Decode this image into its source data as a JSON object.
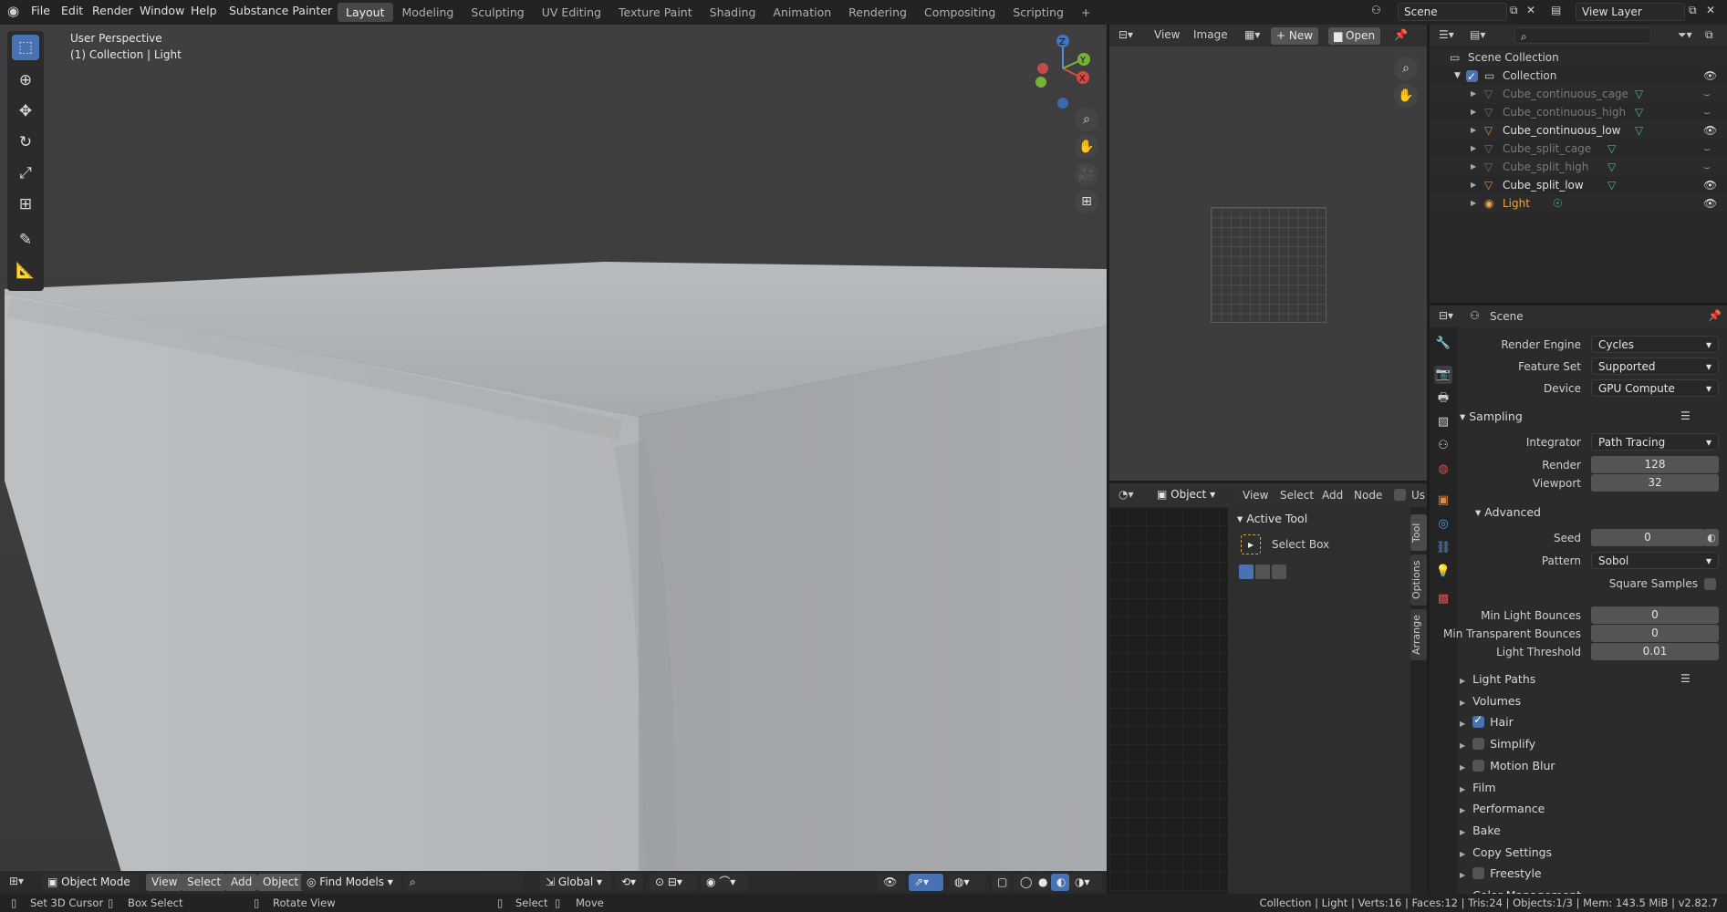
{
  "menu": [
    "File",
    "Edit",
    "Render",
    "Window",
    "Help",
    "Substance Painter"
  ],
  "workspaces": [
    "Layout",
    "Modeling",
    "Sculpting",
    "UV Editing",
    "Texture Paint",
    "Shading",
    "Animation",
    "Rendering",
    "Compositing",
    "Scripting"
  ],
  "active_workspace": "Layout",
  "scene_name": "Scene",
  "view_layer": "View Layer",
  "viewport": {
    "title": "User Perspective",
    "subtitle": "(1) Collection | Light",
    "mode": "Object Mode",
    "buttons": [
      "View",
      "Select",
      "Add",
      "Object"
    ],
    "find_models": "Find Models",
    "transform": "Global",
    "gizmo": {
      "x": "X",
      "y": "Y",
      "z": "Z"
    }
  },
  "image_editor": {
    "view": "View",
    "image": "Image",
    "new": "New",
    "open": "Open"
  },
  "node_editor": {
    "object": "Object",
    "menu": [
      "View",
      "Select",
      "Add",
      "Node"
    ],
    "use": "Us",
    "active_tool": "Active Tool",
    "select_box": "Select Box",
    "tabs": [
      "Tool",
      "Options",
      "Arrange"
    ]
  },
  "outliner": {
    "scene_collection": "Scene Collection",
    "collection": "Collection",
    "items": [
      {
        "name": "Cube_continuous_cage",
        "dim": true
      },
      {
        "name": "Cube_continuous_high",
        "dim": true
      },
      {
        "name": "Cube_continuous_low",
        "dim": false
      },
      {
        "name": "Cube_split_cage",
        "dim": true
      },
      {
        "name": "Cube_split_high",
        "dim": true
      },
      {
        "name": "Cube_split_low",
        "dim": false
      },
      {
        "name": "Light",
        "dim": false,
        "light": true
      }
    ]
  },
  "properties": {
    "scene": "Scene",
    "render_engine": {
      "label": "Render Engine",
      "value": "Cycles"
    },
    "feature_set": {
      "label": "Feature Set",
      "value": "Supported"
    },
    "device": {
      "label": "Device",
      "value": "GPU Compute"
    },
    "sampling": "Sampling",
    "integrator": {
      "label": "Integrator",
      "value": "Path Tracing"
    },
    "render": {
      "label": "Render",
      "value": "128"
    },
    "viewport": {
      "label": "Viewport",
      "value": "32"
    },
    "advanced": "Advanced",
    "seed": {
      "label": "Seed",
      "value": "0"
    },
    "pattern": {
      "label": "Pattern",
      "value": "Sobol"
    },
    "square_samples": "Square Samples",
    "min_light_bounces": {
      "label": "Min Light Bounces",
      "value": "0"
    },
    "min_transparent_bounces": {
      "label": "Min Transparent Bounces",
      "value": "0"
    },
    "light_threshold": {
      "label": "Light Threshold",
      "value": "0.01"
    },
    "panels": [
      {
        "name": "Light Paths",
        "check": null
      },
      {
        "name": "Volumes",
        "check": null
      },
      {
        "name": "Hair",
        "check": true
      },
      {
        "name": "Simplify",
        "check": false
      },
      {
        "name": "Motion Blur",
        "check": false
      },
      {
        "name": "Film",
        "check": null
      },
      {
        "name": "Performance",
        "check": null
      },
      {
        "name": "Bake",
        "check": null
      },
      {
        "name": "Copy Settings",
        "check": null
      },
      {
        "name": "Freestyle",
        "check": false
      },
      {
        "name": "Color Management",
        "check": null
      }
    ]
  },
  "status": {
    "left": [
      "Set 3D Cursor",
      "Box Select",
      "Rotate View",
      "Select",
      "Move"
    ],
    "right": "Collection | Light | Verts:16 | Faces:12 | Tris:24 | Objects:1/3 | Mem: 143.5 MiB | v2.82.7"
  }
}
